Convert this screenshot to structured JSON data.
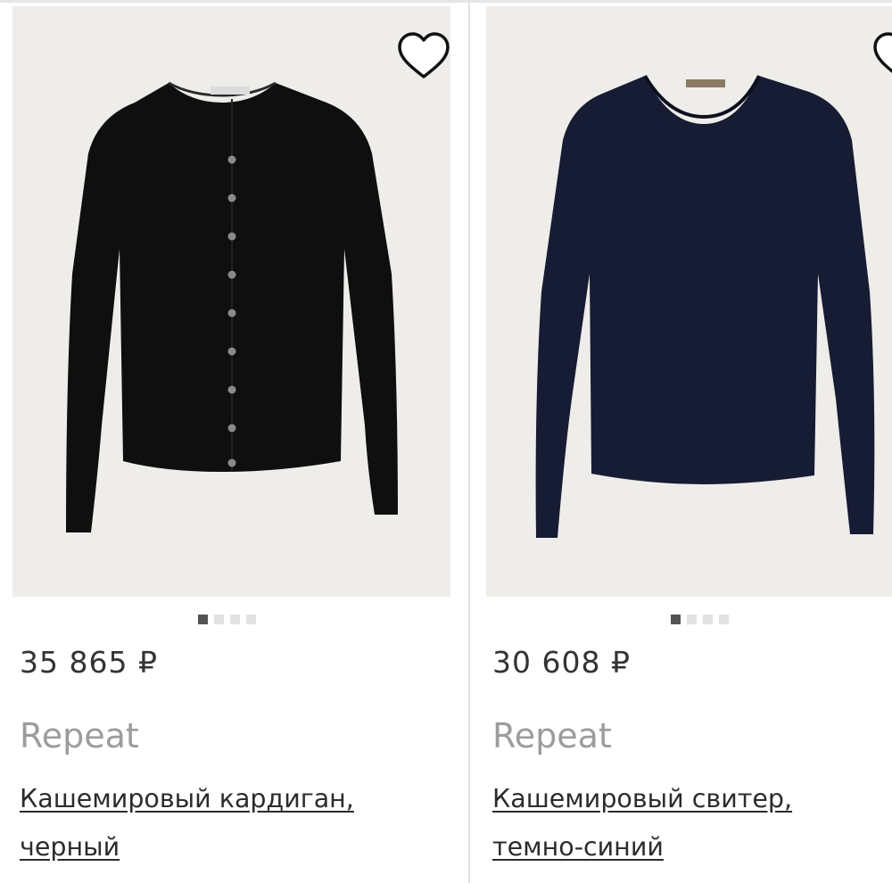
{
  "products": [
    {
      "price": "35 865 ₽",
      "brand": "Repeat",
      "title_line1": "Кашемировый кардиган,",
      "title_line2": "черный",
      "garment_color": "#0f0f0f",
      "image_dots": {
        "count": 4,
        "active": 1
      }
    },
    {
      "price": "30 608 ₽",
      "brand": "Repeat",
      "title_line1": "Кашемировый свитер,",
      "title_line2": "темно-синий",
      "garment_color": "#161c33",
      "image_dots": {
        "count": 4,
        "active": 1
      }
    }
  ],
  "colors": {
    "photo_background": "#efedea",
    "active_dot": "#545454",
    "inactive_dot": "#e2e2e2",
    "brand_text": "#9c9c9c"
  },
  "icons": {
    "favorite": "heart-outline-icon"
  }
}
